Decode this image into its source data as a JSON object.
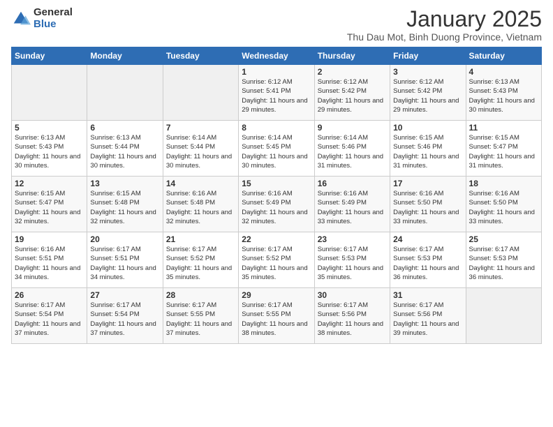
{
  "logo": {
    "general": "General",
    "blue": "Blue"
  },
  "title": "January 2025",
  "subtitle": "Thu Dau Mot, Binh Duong Province, Vietnam",
  "days_of_week": [
    "Sunday",
    "Monday",
    "Tuesday",
    "Wednesday",
    "Thursday",
    "Friday",
    "Saturday"
  ],
  "weeks": [
    [
      {
        "day": "",
        "info": ""
      },
      {
        "day": "",
        "info": ""
      },
      {
        "day": "",
        "info": ""
      },
      {
        "day": "1",
        "info": "Sunrise: 6:12 AM\nSunset: 5:41 PM\nDaylight: 11 hours and 29 minutes."
      },
      {
        "day": "2",
        "info": "Sunrise: 6:12 AM\nSunset: 5:42 PM\nDaylight: 11 hours and 29 minutes."
      },
      {
        "day": "3",
        "info": "Sunrise: 6:12 AM\nSunset: 5:42 PM\nDaylight: 11 hours and 29 minutes."
      },
      {
        "day": "4",
        "info": "Sunrise: 6:13 AM\nSunset: 5:43 PM\nDaylight: 11 hours and 30 minutes."
      }
    ],
    [
      {
        "day": "5",
        "info": "Sunrise: 6:13 AM\nSunset: 5:43 PM\nDaylight: 11 hours and 30 minutes."
      },
      {
        "day": "6",
        "info": "Sunrise: 6:13 AM\nSunset: 5:44 PM\nDaylight: 11 hours and 30 minutes."
      },
      {
        "day": "7",
        "info": "Sunrise: 6:14 AM\nSunset: 5:44 PM\nDaylight: 11 hours and 30 minutes."
      },
      {
        "day": "8",
        "info": "Sunrise: 6:14 AM\nSunset: 5:45 PM\nDaylight: 11 hours and 30 minutes."
      },
      {
        "day": "9",
        "info": "Sunrise: 6:14 AM\nSunset: 5:46 PM\nDaylight: 11 hours and 31 minutes."
      },
      {
        "day": "10",
        "info": "Sunrise: 6:15 AM\nSunset: 5:46 PM\nDaylight: 11 hours and 31 minutes."
      },
      {
        "day": "11",
        "info": "Sunrise: 6:15 AM\nSunset: 5:47 PM\nDaylight: 11 hours and 31 minutes."
      }
    ],
    [
      {
        "day": "12",
        "info": "Sunrise: 6:15 AM\nSunset: 5:47 PM\nDaylight: 11 hours and 32 minutes."
      },
      {
        "day": "13",
        "info": "Sunrise: 6:15 AM\nSunset: 5:48 PM\nDaylight: 11 hours and 32 minutes."
      },
      {
        "day": "14",
        "info": "Sunrise: 6:16 AM\nSunset: 5:48 PM\nDaylight: 11 hours and 32 minutes."
      },
      {
        "day": "15",
        "info": "Sunrise: 6:16 AM\nSunset: 5:49 PM\nDaylight: 11 hours and 32 minutes."
      },
      {
        "day": "16",
        "info": "Sunrise: 6:16 AM\nSunset: 5:49 PM\nDaylight: 11 hours and 33 minutes."
      },
      {
        "day": "17",
        "info": "Sunrise: 6:16 AM\nSunset: 5:50 PM\nDaylight: 11 hours and 33 minutes."
      },
      {
        "day": "18",
        "info": "Sunrise: 6:16 AM\nSunset: 5:50 PM\nDaylight: 11 hours and 33 minutes."
      }
    ],
    [
      {
        "day": "19",
        "info": "Sunrise: 6:16 AM\nSunset: 5:51 PM\nDaylight: 11 hours and 34 minutes."
      },
      {
        "day": "20",
        "info": "Sunrise: 6:17 AM\nSunset: 5:51 PM\nDaylight: 11 hours and 34 minutes."
      },
      {
        "day": "21",
        "info": "Sunrise: 6:17 AM\nSunset: 5:52 PM\nDaylight: 11 hours and 35 minutes."
      },
      {
        "day": "22",
        "info": "Sunrise: 6:17 AM\nSunset: 5:52 PM\nDaylight: 11 hours and 35 minutes."
      },
      {
        "day": "23",
        "info": "Sunrise: 6:17 AM\nSunset: 5:53 PM\nDaylight: 11 hours and 35 minutes."
      },
      {
        "day": "24",
        "info": "Sunrise: 6:17 AM\nSunset: 5:53 PM\nDaylight: 11 hours and 36 minutes."
      },
      {
        "day": "25",
        "info": "Sunrise: 6:17 AM\nSunset: 5:53 PM\nDaylight: 11 hours and 36 minutes."
      }
    ],
    [
      {
        "day": "26",
        "info": "Sunrise: 6:17 AM\nSunset: 5:54 PM\nDaylight: 11 hours and 37 minutes."
      },
      {
        "day": "27",
        "info": "Sunrise: 6:17 AM\nSunset: 5:54 PM\nDaylight: 11 hours and 37 minutes."
      },
      {
        "day": "28",
        "info": "Sunrise: 6:17 AM\nSunset: 5:55 PM\nDaylight: 11 hours and 37 minutes."
      },
      {
        "day": "29",
        "info": "Sunrise: 6:17 AM\nSunset: 5:55 PM\nDaylight: 11 hours and 38 minutes."
      },
      {
        "day": "30",
        "info": "Sunrise: 6:17 AM\nSunset: 5:56 PM\nDaylight: 11 hours and 38 minutes."
      },
      {
        "day": "31",
        "info": "Sunrise: 6:17 AM\nSunset: 5:56 PM\nDaylight: 11 hours and 39 minutes."
      },
      {
        "day": "",
        "info": ""
      }
    ]
  ]
}
